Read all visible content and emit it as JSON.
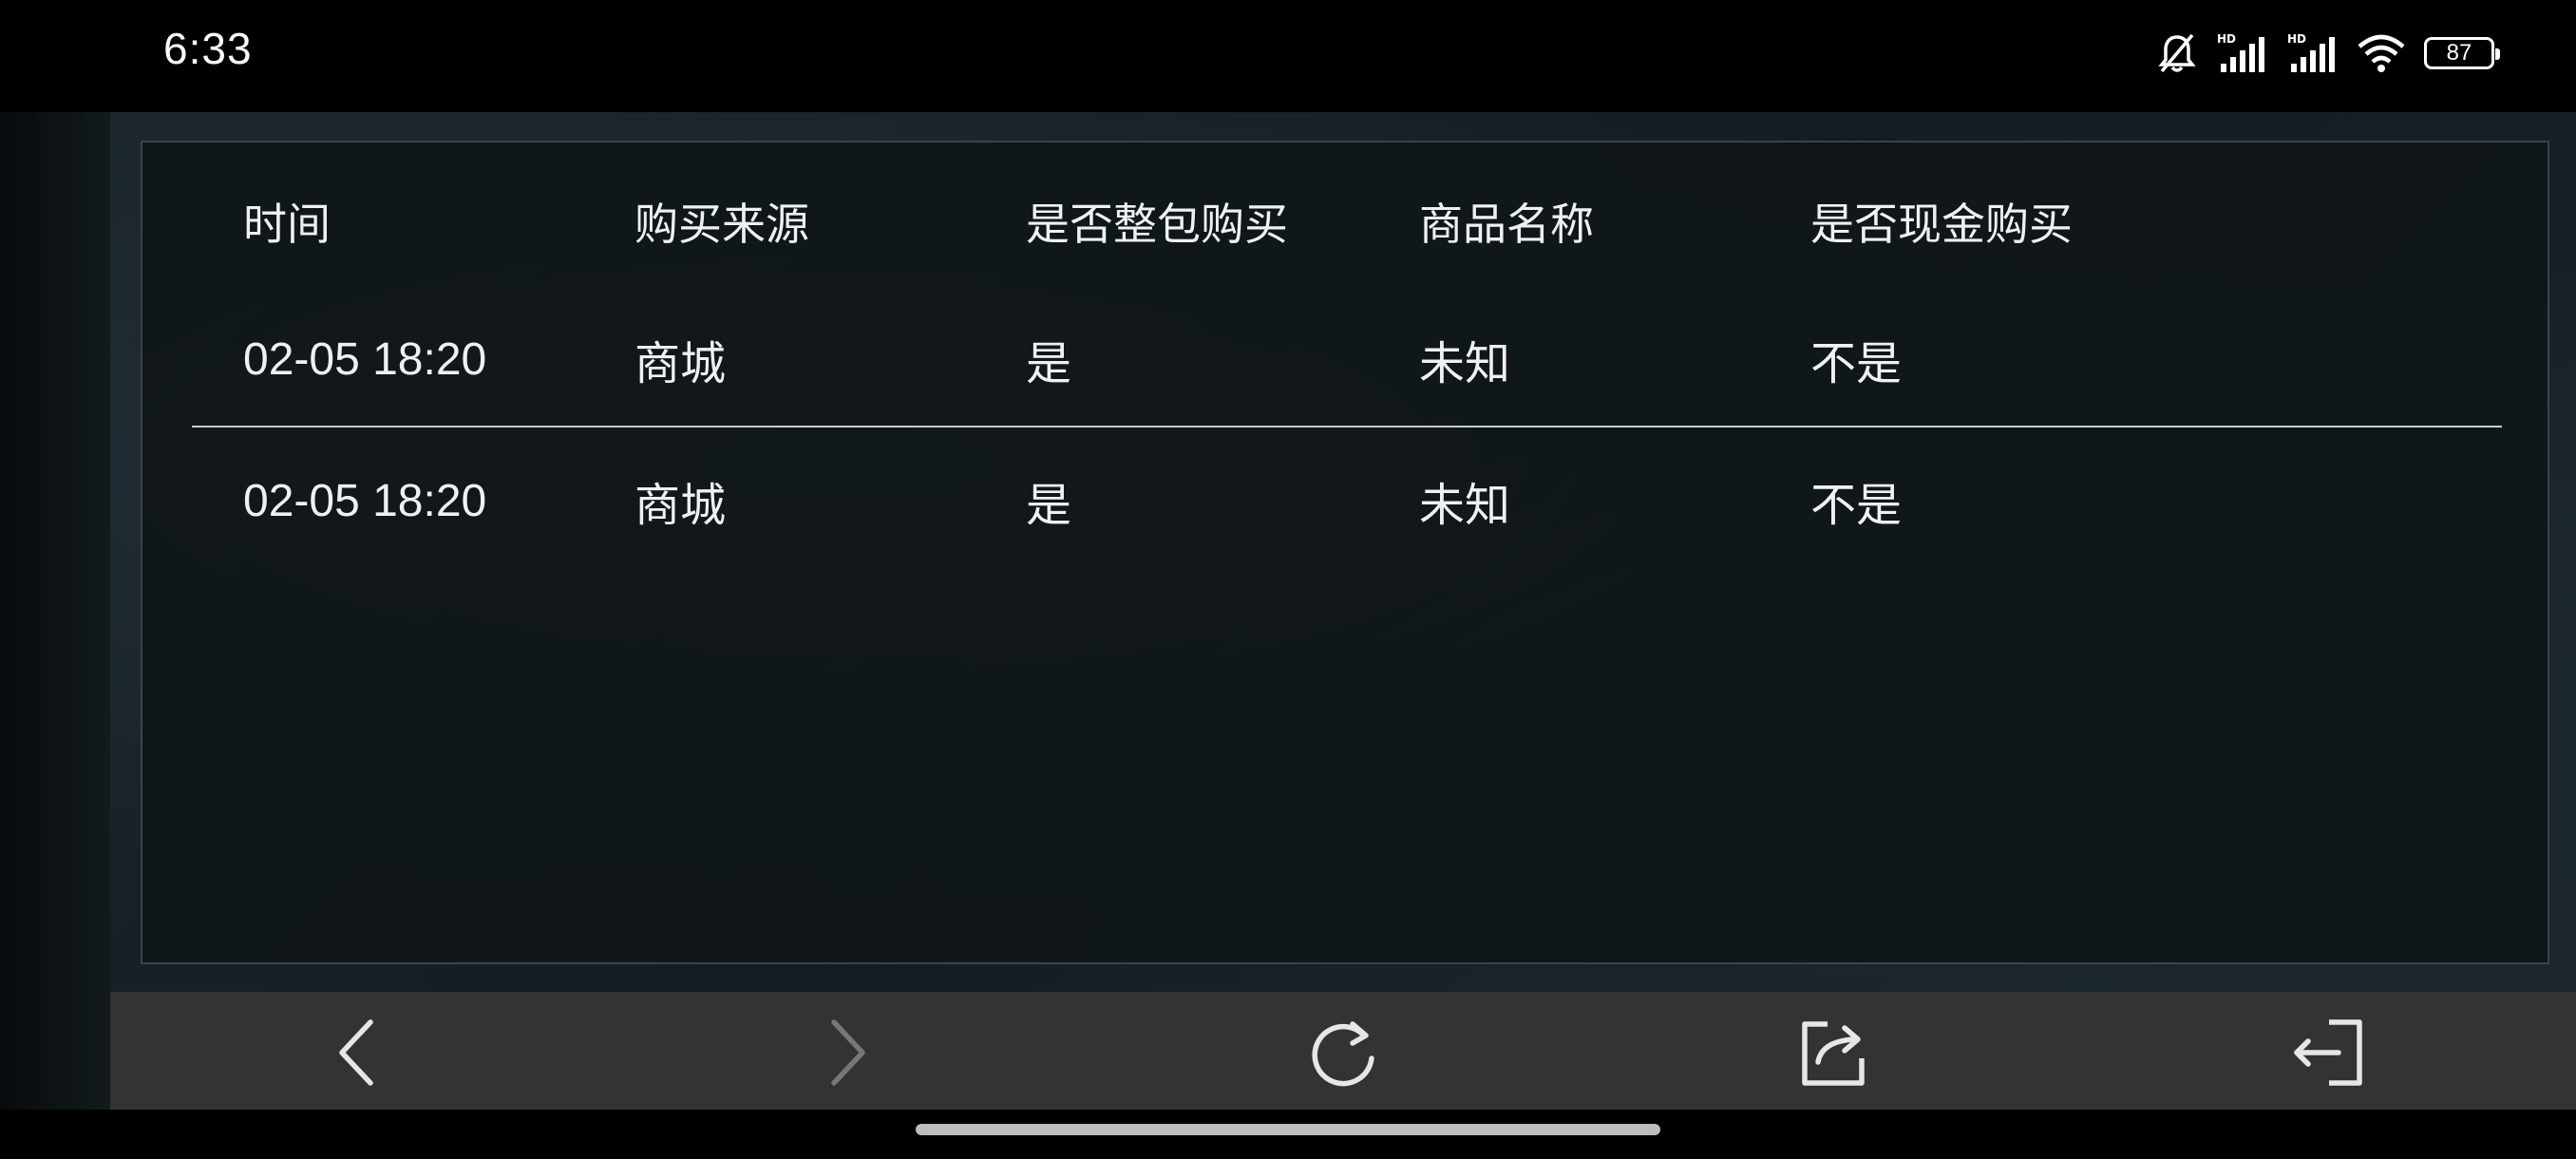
{
  "status_bar": {
    "time": "6:33",
    "battery_level": "87",
    "icons": [
      "mute-bell-icon",
      "signal-hd-icon",
      "signal-hd-icon",
      "wifi-icon",
      "battery-icon"
    ]
  },
  "table": {
    "headers": [
      "时间",
      "购买来源",
      "是否整包购买",
      "商品名称",
      "是否现金购买"
    ],
    "rows": [
      [
        "02-05 18:20",
        "商城",
        "是",
        "未知",
        "不是"
      ],
      [
        "02-05 18:20",
        "商城",
        "是",
        "未知",
        "不是"
      ]
    ]
  },
  "nav": {
    "icons": [
      "back-arrow-icon",
      "forward-arrow-icon",
      "refresh-icon",
      "share-icon",
      "exit-icon"
    ]
  },
  "colors": {
    "panel_bg": "#101619",
    "nav_bg": "#333333",
    "divider": "#c9cdd0",
    "forward_disabled": "#777777"
  }
}
